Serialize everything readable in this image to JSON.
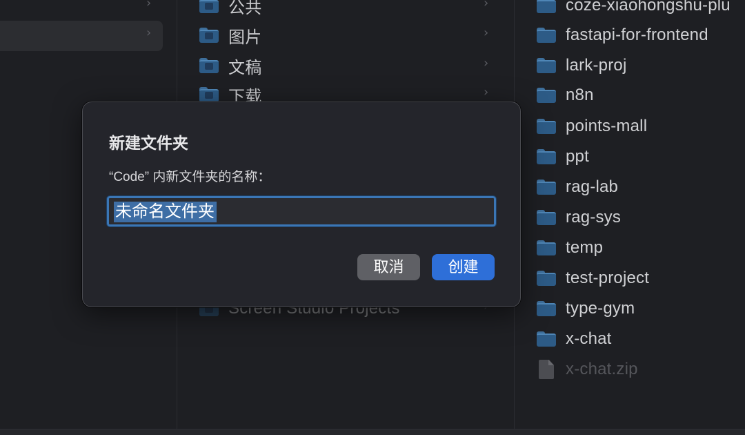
{
  "column2": {
    "items": [
      {
        "label": "公共"
      },
      {
        "label": "图片"
      },
      {
        "label": "文稿"
      },
      {
        "label": "下载"
      },
      {
        "label": "Screen Studio Projects"
      }
    ]
  },
  "column3": {
    "items": [
      {
        "label": "coze-xiaohongshu-plu"
      },
      {
        "label": "fastapi-for-frontend"
      },
      {
        "label": "lark-proj"
      },
      {
        "label": "n8n"
      },
      {
        "label": "points-mall"
      },
      {
        "label": "ppt"
      },
      {
        "label": "rag-lab"
      },
      {
        "label": "rag-sys"
      },
      {
        "label": "temp"
      },
      {
        "label": "test-project"
      },
      {
        "label": "type-gym"
      },
      {
        "label": "x-chat"
      },
      {
        "label": "x-chat.zip"
      }
    ]
  },
  "dialog": {
    "title": "新建文件夹",
    "prompt": "“Code” 内新文件夹的名称：",
    "input_value": "未命名文件夹",
    "cancel_label": "取消",
    "create_label": "创建"
  },
  "icons": {
    "chevron": "chevron-right-icon",
    "folder": "folder-icon",
    "zip": "zip-file-icon"
  },
  "colors": {
    "accent": "#2e6fd8",
    "selection": "#3e6ea5",
    "folder": "#2d5b86"
  }
}
